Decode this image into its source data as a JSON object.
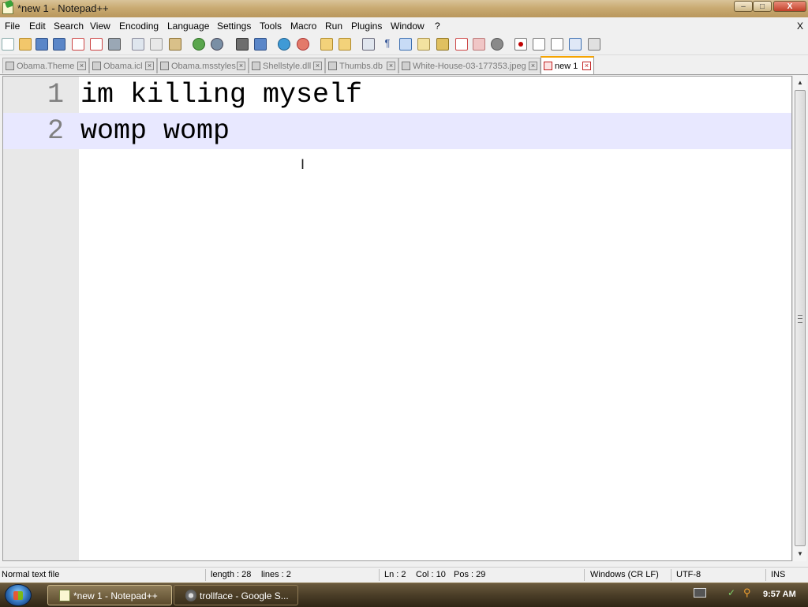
{
  "window": {
    "title": "*new 1 - Notepad++",
    "controls": {
      "minimize": "‒",
      "maximize": "□",
      "close": "X"
    }
  },
  "menu": {
    "items": [
      "File",
      "Edit",
      "Search",
      "View",
      "Encoding",
      "Language",
      "Settings",
      "Tools",
      "Macro",
      "Run",
      "Plugins",
      "Window",
      "?"
    ],
    "close_doc": "X"
  },
  "toolbar": {
    "icons": [
      "new-file-icon",
      "open-file-icon",
      "save-icon",
      "save-all-icon",
      "close-icon",
      "close-all-icon",
      "print-icon",
      "cut-icon",
      "copy-icon",
      "paste-icon",
      "undo-icon",
      "redo-icon",
      "find-icon",
      "replace-icon",
      "zoom-in-icon",
      "zoom-out-icon",
      "sync-vertical-icon",
      "sync-horizontal-icon",
      "word-wrap-icon",
      "show-all-chars-icon",
      "indent-guide-icon",
      "user-lang-icon",
      "doc-map-icon",
      "function-list-icon",
      "folder-workspace-icon",
      "monitoring-icon",
      "record-macro-icon",
      "stop-record-icon",
      "play-macro-icon",
      "run-macro-multiple-icon",
      "save-macro-icon"
    ]
  },
  "tabs": [
    {
      "label": "Obama.Theme",
      "active": false
    },
    {
      "label": "Obama.icl",
      "active": false
    },
    {
      "label": "Obama.msstyles",
      "active": false
    },
    {
      "label": "Shellstyle.dll",
      "active": false
    },
    {
      "label": "Thumbs.db",
      "active": false
    },
    {
      "label": "White-House-03-177353.jpeg",
      "active": false
    },
    {
      "label": "new 1",
      "active": true
    }
  ],
  "editor": {
    "lines": [
      {
        "number": "1",
        "text": "im killing myself"
      },
      {
        "number": "2",
        "text": "womp womp"
      }
    ],
    "current_line": 2,
    "cursor_glyph": "I"
  },
  "statusbar": {
    "file_type": "Normal text file",
    "length": "length : 28",
    "lines": "lines : 2",
    "ln": "Ln : 2",
    "col": "Col : 10",
    "pos": "Pos : 29",
    "eol": "Windows (CR LF)",
    "encoding": "UTF-8",
    "mode": "INS"
  },
  "taskbar": {
    "items": [
      {
        "label": "*new 1 - Notepad++",
        "active": true
      },
      {
        "label": "trollface - Google S...",
        "active": false
      }
    ],
    "clock": "9:57 AM"
  },
  "colors": {
    "current_line_bg": "#e8e8ff",
    "gutter_bg": "#e8e8e8",
    "active_tab_accent": "#f6a400",
    "line_number_fg": "#808080"
  }
}
